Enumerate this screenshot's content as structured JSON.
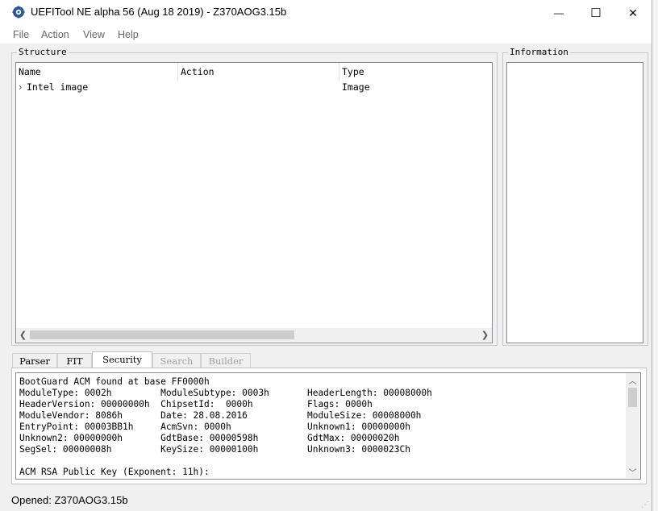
{
  "window": {
    "title": "UEFITool NE alpha 56 (Aug 18 2019) - Z370AOG3.15b",
    "minimize_glyph": "—",
    "maximize_glyph": "☐",
    "close_glyph": "✕"
  },
  "menu": [
    "File",
    "Action",
    "View",
    "Help"
  ],
  "structure": {
    "title": "Structure",
    "columns": [
      "Name",
      "Action",
      "Type"
    ],
    "rows": [
      {
        "name": "Intel image",
        "action": "",
        "type": "Image",
        "expand_glyph": "›"
      }
    ]
  },
  "information": {
    "title": "Information"
  },
  "tabs": [
    "Parser",
    "FIT",
    "Security",
    "Search",
    "Builder"
  ],
  "security": {
    "lines": [
      "BootGuard ACM found at base FF0000h",
      "ModuleType: 0002h         ModuleSubtype: 0003h       HeaderLength: 00008000h",
      "HeaderVersion: 00000000h  ChipsetId:  0000h          Flags: 0000h",
      "ModuleVendor: 8086h       Date: 28.08.2016           ModuleSize: 00008000h",
      "EntryPoint: 00003BB1h     AcmSvn: 0000h              Unknown1: 00000000h",
      "Unknown2: 00000000h       GdtBase: 00000598h         GdtMax: 00000020h",
      "SegSel: 00000008h         KeySize: 00000100h         Unknown3: 0000023Ch",
      "",
      "ACM RSA Public Key (Exponent: 11h):"
    ]
  },
  "status": {
    "text": "Opened: Z370AOG3.15b"
  },
  "colors": {
    "accent": "#2b5797",
    "border": "#828790"
  }
}
